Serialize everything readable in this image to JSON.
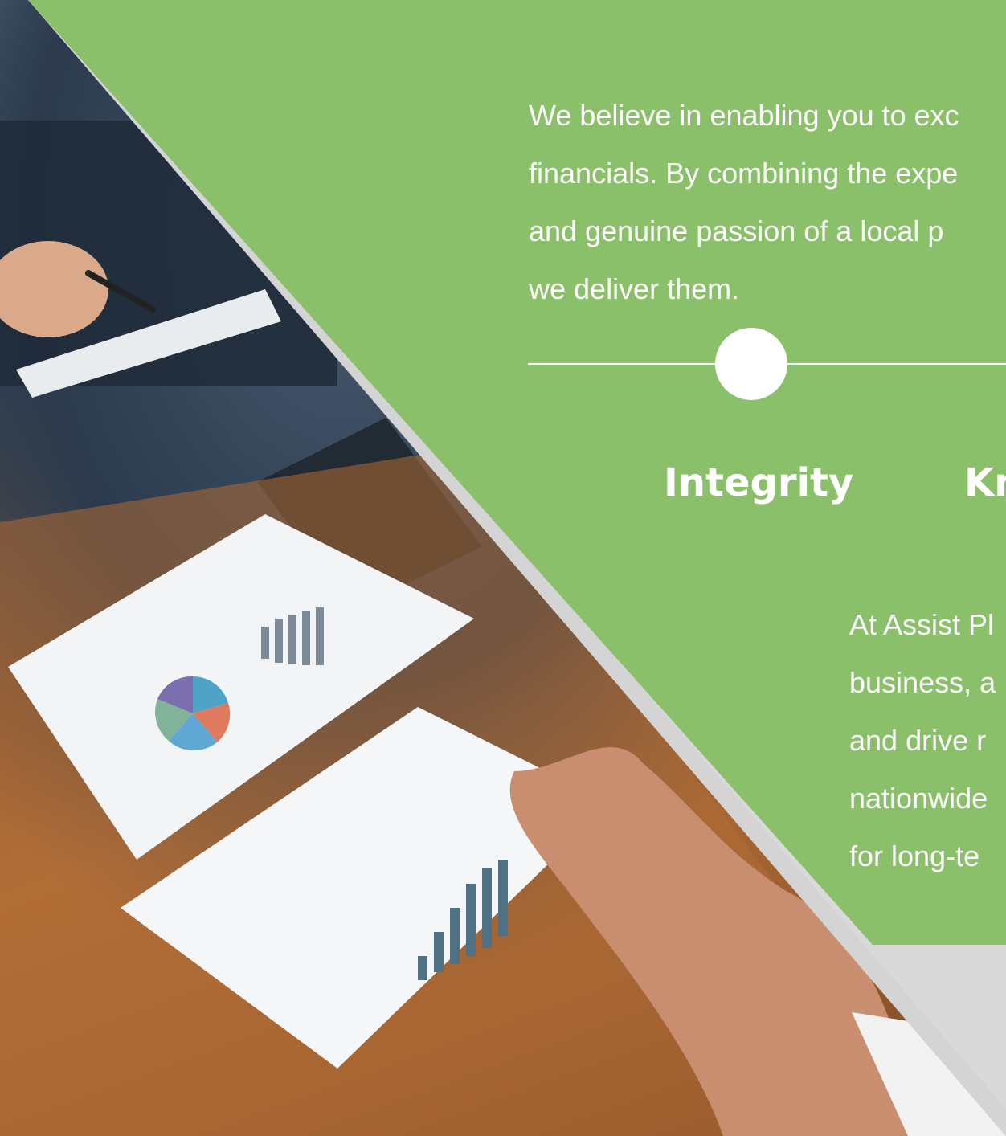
{
  "colors": {
    "panel_green": "#8bc06a",
    "background_gray": "#d9d9d9",
    "text_white": "#ffffff"
  },
  "intro": {
    "lines": [
      "We believe in enabling you to exc",
      "financials. By combining the expe",
      "and genuine passion of a local p",
      "we deliver them."
    ]
  },
  "values": {
    "first": "Integrity",
    "second": "Kn"
  },
  "body": {
    "lines": [
      "At Assist Pl",
      "business, a",
      "and drive r",
      "nationwide",
      "for long-te"
    ]
  },
  "photo": {
    "description_icon": "business-meeting-photo"
  }
}
